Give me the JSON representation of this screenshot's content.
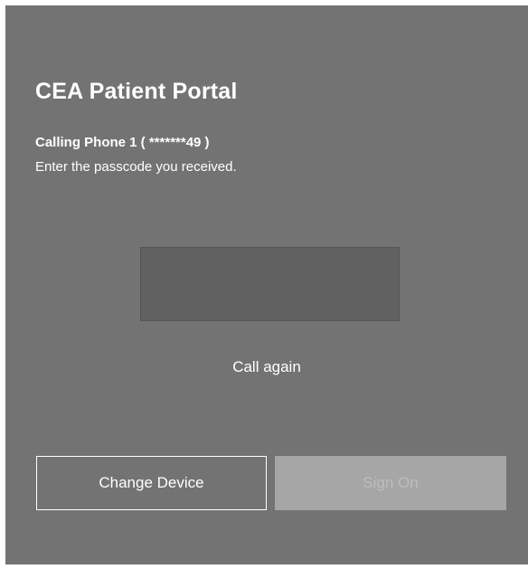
{
  "portal": {
    "title": "CEA Patient Portal",
    "calling_text": "Calling Phone 1 ( *******49 )",
    "instructions": "Enter the passcode you received.",
    "passcode": {
      "value": "",
      "placeholder": ""
    },
    "call_again_label": "Call again",
    "change_device_label": "Change Device",
    "sign_on_label": "Sign On"
  },
  "colors": {
    "panel_bg": "#737373",
    "input_bg": "#616161",
    "sign_on_disabled_bg": "#a6a6a6",
    "text": "#ffffff"
  }
}
